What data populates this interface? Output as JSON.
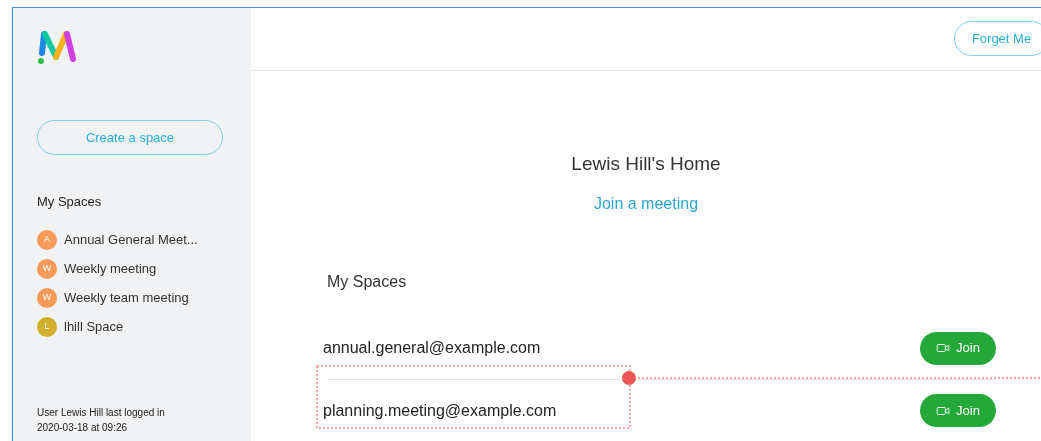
{
  "sidebar": {
    "create_button": "Create a space",
    "heading": "My Spaces",
    "items": [
      {
        "initial": "A",
        "name": "Annual General Meet...",
        "color": "#f79a5a"
      },
      {
        "initial": "W",
        "name": "Weekly meeting",
        "color": "#f79a5a"
      },
      {
        "initial": "W",
        "name": "Weekly team meeting",
        "color": "#f79a5a"
      },
      {
        "initial": "L",
        "name": "lhill Space",
        "color": "#d3ae2a"
      }
    ],
    "footer": [
      "User Lewis Hill last logged in",
      "2020-03-18 at 09:26"
    ]
  },
  "header": {
    "forget_button": "Forget Me"
  },
  "main": {
    "title": "Lewis Hill's Home",
    "join_link": "Join a meeting",
    "section": "My Spaces",
    "spaces": [
      {
        "address": "annual.general@example.com",
        "button": "Join",
        "annotated": false
      },
      {
        "address": "planning.meeting@example.com",
        "button": "Join",
        "annotated": true
      }
    ]
  }
}
